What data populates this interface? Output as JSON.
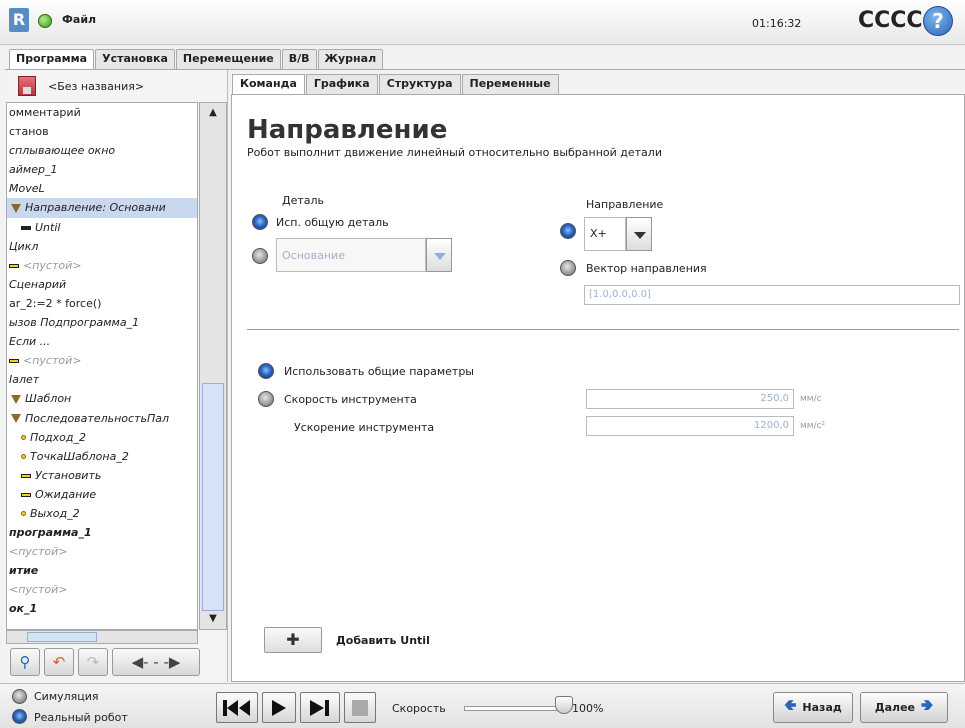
{
  "header": {
    "logo": "R",
    "file_menu": "Файл",
    "time": "01:16:32",
    "robot_name": "CCCC",
    "help": "?"
  },
  "main_tabs": [
    "Программа",
    "Установка",
    "Перемещение",
    "В/В",
    "Журнал"
  ],
  "program": {
    "name": "<Без названия>"
  },
  "tree": [
    {
      "text": "омментарий",
      "indent": 0,
      "style": "",
      "icon": ""
    },
    {
      "text": "станов",
      "indent": 0,
      "style": "",
      "icon": ""
    },
    {
      "text": "сплывающее окно",
      "indent": 0,
      "style": "i",
      "icon": ""
    },
    {
      "text": "аймер_1",
      "indent": 0,
      "style": "i",
      "icon": ""
    },
    {
      "text": "MoveL",
      "indent": 0,
      "style": "i",
      "icon": ""
    },
    {
      "text": "Направление: Основани",
      "indent": 1,
      "style": "i",
      "icon": "tri",
      "selected": true
    },
    {
      "text": "Until",
      "indent": 2,
      "style": "i",
      "icon": "bar"
    },
    {
      "text": "Цикл",
      "indent": 0,
      "style": "i",
      "icon": ""
    },
    {
      "text": "<пустой>",
      "indent": 0,
      "style": "ig",
      "icon": "ybar"
    },
    {
      "text": "Сценарий",
      "indent": 0,
      "style": "i",
      "icon": ""
    },
    {
      "text": "ar_2:=2 * force()",
      "indent": 0,
      "style": "",
      "icon": ""
    },
    {
      "text": "ызов Подпрограмма_1",
      "indent": 0,
      "style": "i",
      "icon": ""
    },
    {
      "text": "Если ...",
      "indent": 0,
      "style": "i",
      "icon": ""
    },
    {
      "text": "<пустой>",
      "indent": 0,
      "style": "ig",
      "icon": "ybar"
    },
    {
      "text": "Іалет",
      "indent": 0,
      "style": "i",
      "icon": ""
    },
    {
      "text": "Шаблон",
      "indent": 1,
      "style": "i",
      "icon": "tri"
    },
    {
      "text": "ПоследовательностьПал",
      "indent": 1,
      "style": "i",
      "icon": "tri"
    },
    {
      "text": "Подход_2",
      "indent": 2,
      "style": "i",
      "icon": "pt"
    },
    {
      "text": "ТочкаШаблона_2",
      "indent": 2,
      "style": "i",
      "icon": "pt"
    },
    {
      "text": "Установить",
      "indent": 2,
      "style": "i",
      "icon": "ybar"
    },
    {
      "text": "Ожидание",
      "indent": 2,
      "style": "i",
      "icon": "ybar"
    },
    {
      "text": "Выход_2",
      "indent": 2,
      "style": "i",
      "icon": "pt"
    },
    {
      "text": "программа_1",
      "indent": 0,
      "style": "ib",
      "icon": ""
    },
    {
      "text": "<пустой>",
      "indent": 0,
      "style": "ig",
      "icon": ""
    },
    {
      "text": "итие",
      "indent": 0,
      "style": "ib",
      "icon": ""
    },
    {
      "text": "<пустой>",
      "indent": 0,
      "style": "ig",
      "icon": ""
    },
    {
      "text": "ок_1",
      "indent": 0,
      "style": "ib",
      "icon": ""
    }
  ],
  "cmd_tabs": [
    "Команда",
    "Графика",
    "Структура",
    "Переменные"
  ],
  "command": {
    "title": "Направление",
    "description": "Робот выполнит движение линейный относительно выбранной детали",
    "feature_label": "Деталь",
    "use_common_feature": "Исп. общую деталь",
    "feature_select": "Основание",
    "direction_label": "Направление",
    "direction_value": "X+",
    "direction_vector_label": "Вектор направления",
    "direction_vector_value": "[1.0,0.0,0.0]",
    "use_shared_params": "Использовать общие параметры",
    "tool_speed_label": "Скорость инструмента",
    "tool_speed_value": "250,0",
    "tool_speed_unit": "мм/с",
    "tool_accel_label": "Ускорение инструмента",
    "tool_accel_value": "1200,0",
    "tool_accel_unit": "мм/с²",
    "add_until": "Добавить Until"
  },
  "footer": {
    "simulation": "Симуляция",
    "real_robot": "Реальный робот",
    "speed_label": "Скорость",
    "speed_value": "100%",
    "speed_fraction": 1.0,
    "back": "Назад",
    "next": "Далее"
  }
}
